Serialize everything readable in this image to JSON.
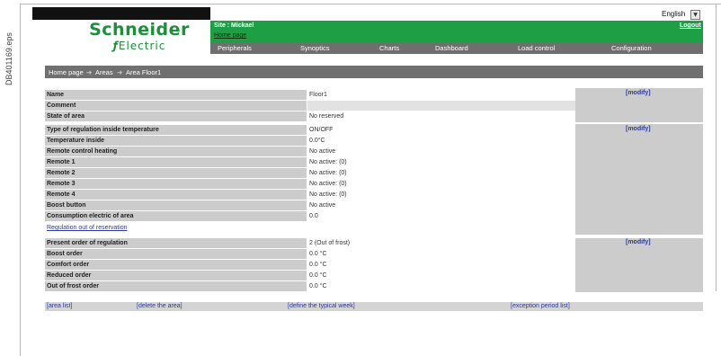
{
  "margin_label": "DB401169.eps",
  "header": {
    "brand": "Schneider",
    "brand_sub": "Electric",
    "language": "English",
    "site": "Site : Mickael",
    "home_link": "Home page",
    "logout": "Logout"
  },
  "nav": [
    "Peripherals",
    "Synoptics",
    "Charts",
    "Dashboard",
    "Load control",
    "Configuration"
  ],
  "breadcrumb": [
    "Home page",
    "Areas",
    "Area Floor1"
  ],
  "section1": [
    {
      "label": "Name",
      "value": "Floor1"
    },
    {
      "label": "Comment",
      "value": ""
    },
    {
      "label": "State of area",
      "value": "No reserved"
    }
  ],
  "section2": [
    {
      "label": "Type of regulation inside temperature",
      "value": "ON/OFF"
    },
    {
      "label": "Temperature inside",
      "value": "0.0°C"
    },
    {
      "label": "Remote control heating",
      "value": "No active"
    },
    {
      "label": "Remote 1",
      "value": "No active: (0)"
    },
    {
      "label": "Remote 2",
      "value": "No active: (0)"
    },
    {
      "label": "Remote 3",
      "value": "No active: (0)"
    },
    {
      "label": "Remote 4",
      "value": "No active: (0)"
    },
    {
      "label": "Boost button",
      "value": "No active"
    },
    {
      "label": "Consumption electric of area",
      "value": "0.0"
    }
  ],
  "regulation_link": "Regulation out of reservation",
  "section3": [
    {
      "label": "Present order of regulation",
      "value": "2 (Out of frost)"
    },
    {
      "label": "Boost order",
      "value": "0.0 °C"
    },
    {
      "label": "Comfort order",
      "value": "0.0 °C"
    },
    {
      "label": "Reduced order",
      "value": "0.0 °C"
    },
    {
      "label": "Out of frost order",
      "value": "0.0 °C"
    }
  ],
  "modify_label": "[modify]",
  "footer_links": [
    "[area list]",
    "[delete the area]",
    "[define the typical week]",
    "[exception period list]"
  ]
}
